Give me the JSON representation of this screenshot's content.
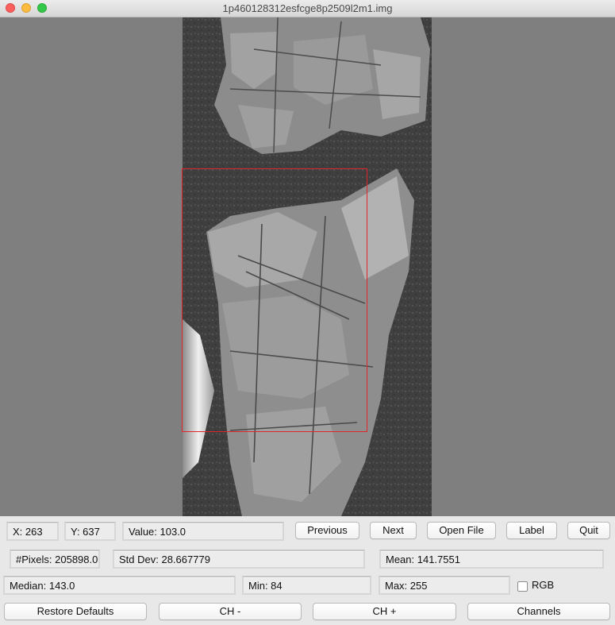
{
  "window": {
    "title": "1p460128312esfcge8p2509l2m1.img"
  },
  "readouts": {
    "x": "X: 263",
    "y": "Y: 637",
    "value": "Value: 103.0",
    "pixels": "#Pixels: 205898.0",
    "std_dev": "Std Dev: 28.667779",
    "mean": "Mean: 141.7551",
    "median": "Median: 143.0",
    "min": "Min: 84",
    "max": "Max: 255"
  },
  "nav_buttons": {
    "previous": "Previous",
    "next": "Next",
    "open_file": "Open File",
    "label": "Label",
    "quit": "Quit"
  },
  "rgb": {
    "label": "RGB",
    "checked": false
  },
  "bottom_buttons": {
    "restore_defaults": "Restore Defaults",
    "ch_minus": "CH -",
    "ch_plus": "CH +",
    "channels": "Channels"
  },
  "colors": {
    "canvas_background": "#7f7f7f",
    "roi_outline": "#e0262a"
  }
}
